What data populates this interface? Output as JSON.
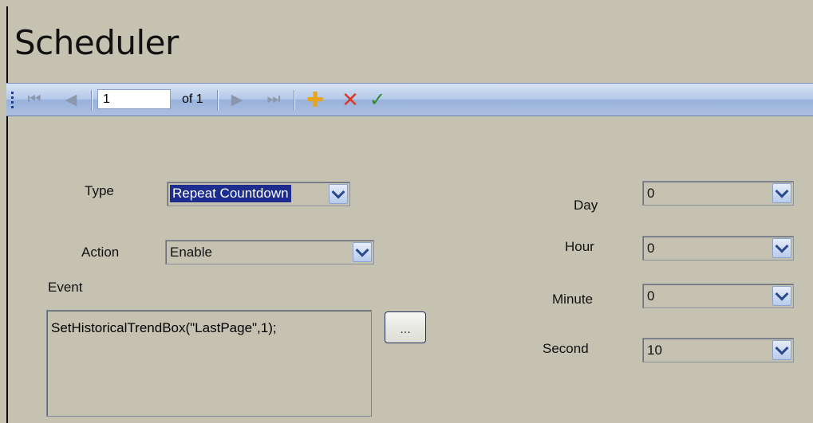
{
  "window": {
    "title": "Scheduler"
  },
  "toolbar": {
    "position_value": "1",
    "of_label": "of 1",
    "icons": [
      "grip-icon",
      "first-icon",
      "prev-icon",
      "next-icon",
      "last-icon",
      "add-icon",
      "delete-icon",
      "apply-icon"
    ],
    "glyphs": {
      "first": "⏮",
      "prev": "◀",
      "next": "▶",
      "last": "⏭",
      "add": "✚",
      "delete": "✕",
      "apply": "✓"
    }
  },
  "form": {
    "type": {
      "label": "Type",
      "value": "Repeat Countdown"
    },
    "action": {
      "label": "Action",
      "value": "Enable"
    },
    "event": {
      "label": "Event",
      "value": "SetHistoricalTrendBox(\"LastPage\",1);",
      "browse_label": "..."
    },
    "day": {
      "label": "Day",
      "value": "0"
    },
    "hour": {
      "label": "Hour",
      "value": "0"
    },
    "minute": {
      "label": "Minute",
      "value": "0"
    },
    "second": {
      "label": "Second",
      "value": "10"
    }
  },
  "colors": {
    "background": "#c5c2b2",
    "toolbar": "#b4c8e8",
    "selection": "#1c2d8f"
  }
}
